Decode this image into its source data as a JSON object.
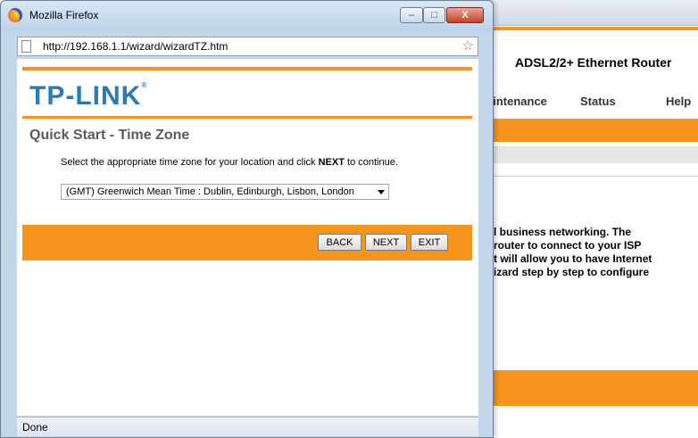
{
  "background_page": {
    "product_name": "ADSL2/2+ Ethernet Router",
    "nav": [
      "aintenance",
      "Status",
      "Help"
    ],
    "intro_lines": [
      "l business networking. The",
      "router to connect to your ISP",
      "t will allow you to have Internet",
      "izard step by step to configure"
    ]
  },
  "window": {
    "title": "Mozilla Firefox",
    "minimize_glyph": "–",
    "maximize_glyph": "□",
    "close_glyph": "X",
    "url": "http://192.168.1.1/wizard/wizardTZ.htm",
    "status": "Done"
  },
  "wizard": {
    "logo_text": "TP-LINK",
    "logo_mark": "®",
    "title": "Quick Start - Time Zone",
    "instruction_before": "Select the appropriate time zone for your location and click ",
    "instruction_bold": "NEXT",
    "instruction_after": " to continue.",
    "timezone_selected": "(GMT) Greenwich Mean Time : Dublin, Edinburgh, Lisbon, London",
    "buttons": {
      "back": "BACK",
      "next": "NEXT",
      "exit": "EXIT"
    }
  },
  "colors": {
    "accent": "#f7941d",
    "logo": "#2a7ab8"
  }
}
